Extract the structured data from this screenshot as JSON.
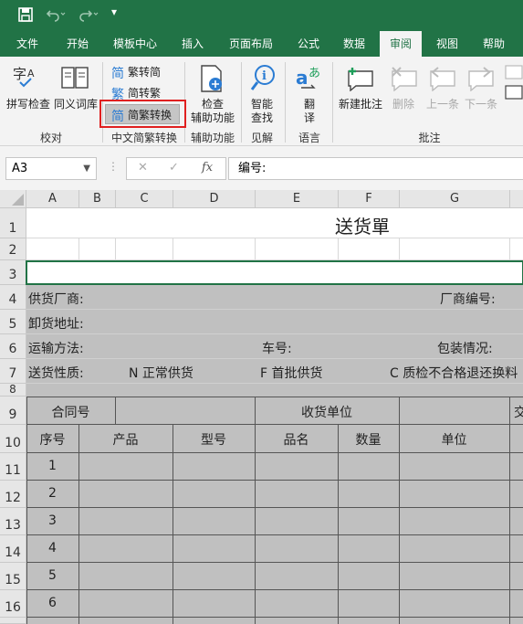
{
  "quick_access": {
    "save": "save",
    "undo": "undo",
    "redo": "redo",
    "customize": "▾"
  },
  "tabs": [
    {
      "label": "文件",
      "active": false
    },
    {
      "label": "开始",
      "active": false
    },
    {
      "label": "模板中心",
      "active": false
    },
    {
      "label": "插入",
      "active": false
    },
    {
      "label": "页面布局",
      "active": false
    },
    {
      "label": "公式",
      "active": false
    },
    {
      "label": "数据",
      "active": false
    },
    {
      "label": "审阅",
      "active": true
    },
    {
      "label": "视图",
      "active": false
    },
    {
      "label": "帮助",
      "active": false
    }
  ],
  "ribbon": {
    "proofing": {
      "spell": "拼写检查",
      "thesaurus": "同义词库",
      "group": "校对"
    },
    "chinese": {
      "to_trad": "繁转简",
      "to_simp": "简转繁",
      "convert": "简繁转换",
      "group": "中文简繁转换"
    },
    "access": {
      "check": "检查",
      "check2": "辅助功能",
      "group": "辅助功能"
    },
    "insights": {
      "smart": "智能",
      "smart2": "查找",
      "group": "见解"
    },
    "language": {
      "translate": "翻",
      "translate2": "译",
      "group": "语言"
    },
    "comments": {
      "new": "新建批注",
      "delete": "删除",
      "prev": "上一条",
      "next": "下一条",
      "group": "批注"
    }
  },
  "formula_bar": {
    "name_box": "A3",
    "cancel": "✕",
    "enter": "✓",
    "fx": "fx",
    "content": "编号:"
  },
  "columns": [
    "A",
    "B",
    "C",
    "D",
    "E",
    "F",
    "G"
  ],
  "rows": [
    "1",
    "2",
    "3",
    "4",
    "5",
    "6",
    "7",
    "8",
    "9",
    "10",
    "11",
    "12",
    "13",
    "14",
    "15",
    "16"
  ],
  "sheet": {
    "title": "送货單",
    "supplier": "供货厂商:",
    "supplier_code": "厂商编号:",
    "unload": "卸货地址:",
    "transport": "运输方法:",
    "car_no": "车号:",
    "packing": "包装情况:",
    "delivery_type": "送货性质:",
    "opt_n": "N 正常供货",
    "opt_f": "F  首批供货",
    "opt_c": "C  质检不合格退还换料",
    "contract": "合同号",
    "receiver": "收货单位",
    "cut": "交",
    "h_seq": "序号",
    "h_product": "产品",
    "h_model": "型号",
    "h_name": "品名",
    "h_qty": "数量",
    "h_unit": "单位",
    "seq": [
      "1",
      "2",
      "3",
      "4",
      "5",
      "6"
    ]
  }
}
